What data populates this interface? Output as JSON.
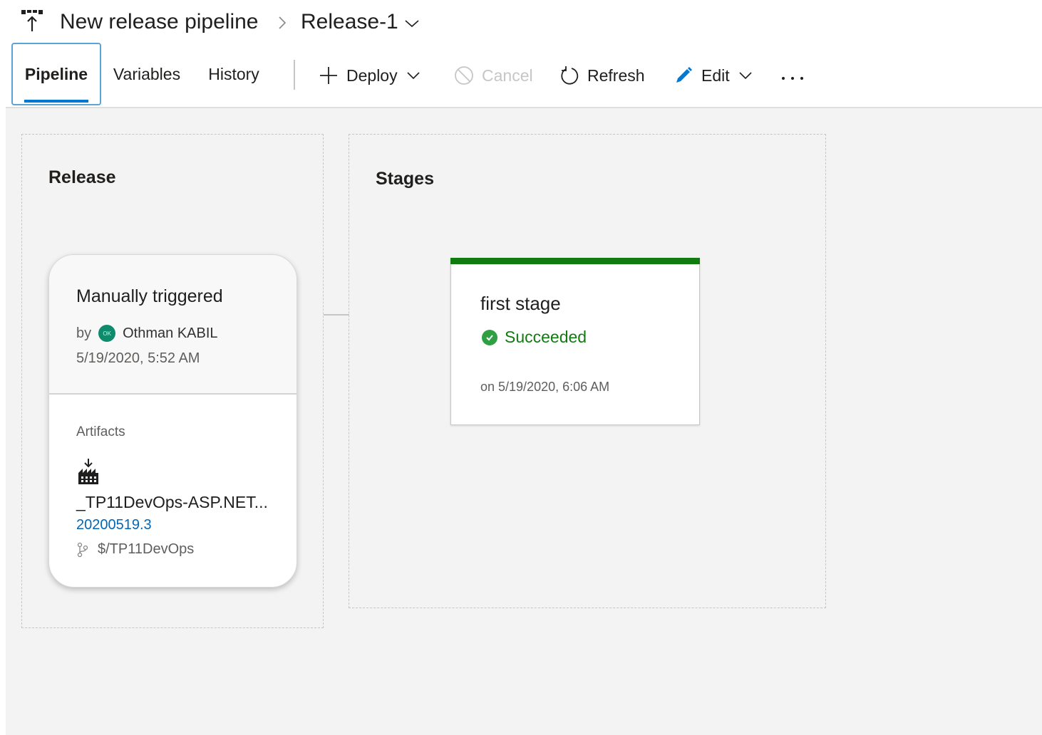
{
  "breadcrumb": {
    "pipeline_name": "New release pipeline",
    "release_name": "Release-1"
  },
  "tabs": [
    {
      "label": "Pipeline",
      "selected": true
    },
    {
      "label": "Variables",
      "selected": false
    },
    {
      "label": "History",
      "selected": false
    }
  ],
  "toolbar": {
    "deploy_label": "Deploy",
    "cancel_label": "Cancel",
    "refresh_label": "Refresh",
    "edit_label": "Edit",
    "more_label": "..."
  },
  "release_zone": {
    "title": "Release",
    "card": {
      "trigger": "Manually triggered",
      "by_label": "by",
      "user_initials": "OK",
      "user_name": "Othman KABIL",
      "date": "5/19/2020, 5:52 AM",
      "artifacts_label": "Artifacts",
      "artifact_name": "_TP11DevOps-ASP.NET...",
      "build_number": "20200519.3",
      "branch": "$/TP11DevOps"
    }
  },
  "stages_zone": {
    "title": "Stages",
    "stage": {
      "name": "first stage",
      "status": "Succeeded",
      "status_color": "#107c10",
      "time": "on 5/19/2020, 6:06 AM"
    }
  },
  "colors": {
    "accent": "#0078d4",
    "success": "#107c10",
    "link": "#0067b8",
    "canvas_bg": "#f3f3f3"
  }
}
